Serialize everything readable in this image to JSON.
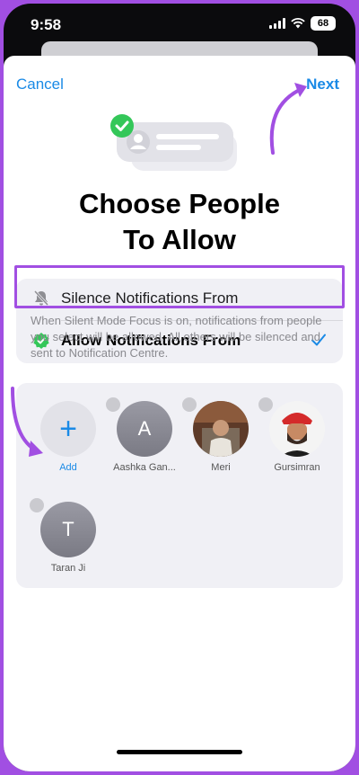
{
  "status_bar": {
    "time": "9:58",
    "battery": "68"
  },
  "nav": {
    "cancel_label": "Cancel",
    "next_label": "Next"
  },
  "title": {
    "line1": "Choose People",
    "line2": "To Allow"
  },
  "options": {
    "silence_label": "Silence Notifications From",
    "allow_label": "Allow Notifications From"
  },
  "description": "When Silent Mode  Focus is on, notifications from people you select will be allowed. All others will be silenced and sent to Notification Centre.",
  "people": [
    {
      "name": "Add",
      "initial": "+",
      "kind": "add"
    },
    {
      "name": "Aashka Gan...",
      "initial": "A",
      "kind": "initial"
    },
    {
      "name": "Meri",
      "initial": "",
      "kind": "photo"
    },
    {
      "name": "Gursimran",
      "initial": "",
      "kind": "photo"
    },
    {
      "name": "Taran Ji",
      "initial": "T",
      "kind": "initial"
    }
  ],
  "colors": {
    "accent": "#1a8ae6",
    "annotation": "#a14fe2",
    "check_green": "#34c759"
  }
}
